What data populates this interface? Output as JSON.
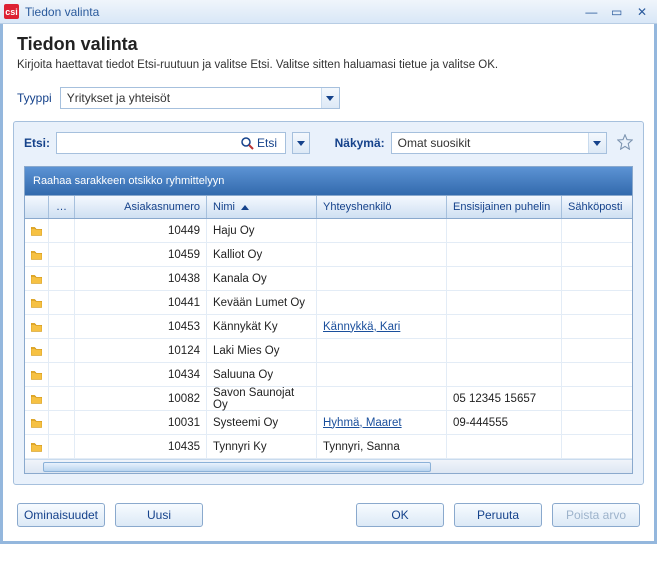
{
  "window": {
    "title": "Tiedon valinta"
  },
  "header": {
    "title": "Tiedon valinta",
    "subtitle": "Kirjoita haettavat tiedot Etsi-ruutuun ja valitse Etsi. Valitse sitten haluamasi tietue ja valitse OK."
  },
  "type": {
    "label": "Tyyppi",
    "value": "Yritykset ja yhteisöt"
  },
  "search": {
    "label": "Etsi:",
    "value": "",
    "placeholder": "",
    "button_label": "Etsi"
  },
  "view": {
    "label": "Näkymä:",
    "value": "Omat suosikit"
  },
  "grid": {
    "group_hint": "Raahaa sarakkeen otsikko ryhmittelyyn",
    "columns": {
      "dots": "…",
      "asnum": "Asiakasnumero",
      "nimi": "Nimi",
      "yht": "Yhteyshenkilö",
      "puh": "Ensisijainen puhelin",
      "email": "Sähköposti"
    },
    "rows": [
      {
        "asnum": "10449",
        "nimi": "Haju Oy",
        "yht": "",
        "puh": "",
        "email": ""
      },
      {
        "asnum": "10459",
        "nimi": "Kalliot Oy",
        "yht": "",
        "puh": "",
        "email": ""
      },
      {
        "asnum": "10438",
        "nimi": "Kanala Oy",
        "yht": "",
        "puh": "",
        "email": ""
      },
      {
        "asnum": "10441",
        "nimi": "Kevään Lumet Oy",
        "yht": "",
        "puh": "",
        "email": ""
      },
      {
        "asnum": "10453",
        "nimi": "Kännykät Ky",
        "yht": "Kännykkä, Kari",
        "yhtlink": true,
        "puh": "",
        "email": ""
      },
      {
        "asnum": "10124",
        "nimi": "Laki Mies Oy",
        "yht": "",
        "puh": "",
        "email": ""
      },
      {
        "asnum": "10434",
        "nimi": "Saluuna Oy",
        "yht": "",
        "puh": "",
        "email": ""
      },
      {
        "asnum": "10082",
        "nimi": "Savon Saunojat Oy",
        "yht": "",
        "puh": "05 12345 15657",
        "email": ""
      },
      {
        "asnum": "10031",
        "nimi": "Systeemi Oy",
        "yht": "Hyhmä, Maaret",
        "yhtlink": true,
        "puh": "09-444555",
        "email": ""
      },
      {
        "asnum": "10435",
        "nimi": "Tynnyri Ky",
        "yht": "Tynnyri, Sanna",
        "puh": "",
        "email": ""
      }
    ]
  },
  "footer": {
    "properties": "Ominaisuudet",
    "new": "Uusi",
    "ok": "OK",
    "cancel": "Peruuta",
    "delete": "Poista arvo"
  }
}
